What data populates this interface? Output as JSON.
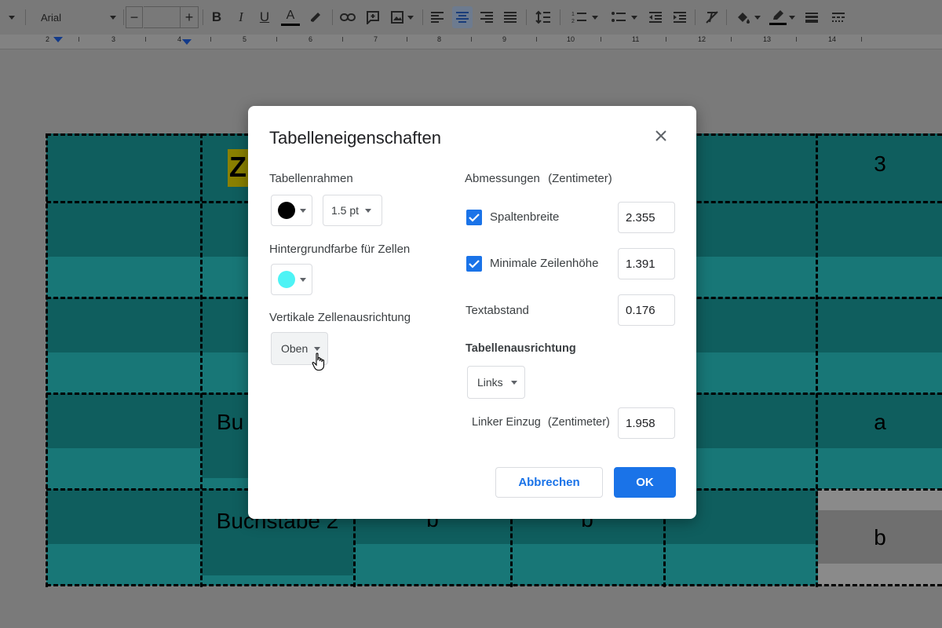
{
  "toolbar": {
    "font_name": "Arial",
    "font_size": "",
    "icons": [
      "menu-caret-icon",
      "font-caret-icon",
      "minus-icon",
      "plus-icon",
      "bold-icon",
      "italic-icon",
      "underline-icon",
      "text-color-icon",
      "highlight-icon",
      "link-icon",
      "comment-icon",
      "image-icon",
      "align-left-icon",
      "align-center-icon",
      "align-right-icon",
      "align-justify-icon",
      "line-spacing-icon",
      "numbered-list-icon",
      "bulleted-list-icon",
      "decrease-indent-icon",
      "increase-indent-icon",
      "clear-format-icon",
      "fill-color-icon",
      "border-color-icon",
      "border-width-icon",
      "border-dash-icon"
    ],
    "bold": "B",
    "italic": "I",
    "underline": "U",
    "text_color": "A",
    "minus": "−",
    "plus": "+"
  },
  "ruler": {
    "numbers": [
      "2",
      "3",
      "4",
      "5",
      "6",
      "7",
      "8",
      "9",
      "10",
      "11",
      "12",
      "13",
      "14"
    ]
  },
  "document_table": {
    "cells": {
      "r0c1": "Z",
      "r0c5": "3",
      "r3c1": "Bu",
      "r3c5": "a",
      "r4c1": "Buchstabe 2",
      "r4c2": "b",
      "r4c3": "b",
      "r4c5": "b"
    },
    "colors": {
      "dark": "#0f5e5e",
      "mid": "#136b6b",
      "light": "#187777",
      "highlight": "#8a8000",
      "gray": "#9a9a9a"
    }
  },
  "dialog": {
    "title": "Tabelleneigenschaften",
    "close_icon": "close-icon",
    "table_border": {
      "label": "Tabellenrahmen",
      "color": "#000000",
      "width": "1.5 pt"
    },
    "cell_background": {
      "label": "Hintergrundfarbe für Zellen",
      "color": "#4ef3f5"
    },
    "vertical_alignment": {
      "label": "Vertikale Zellenausrichtung",
      "value": "Oben"
    },
    "dimensions": {
      "label": "Abmessungen",
      "unit": "(Zentimeter)",
      "column_width": {
        "label": "Spaltenbreite",
        "checked": true,
        "value": "2.355"
      },
      "min_row_height": {
        "label": "Minimale Zeilenhöhe",
        "checked": true,
        "value": "1.391"
      },
      "cell_padding": {
        "label": "Textabstand",
        "value": "0.176"
      }
    },
    "table_alignment": {
      "label": "Tabellenausrichtung",
      "value": "Links"
    },
    "left_indent": {
      "label": "Linker Einzug",
      "unit": "(Zentimeter)",
      "value": "1.958"
    },
    "cancel_label": "Abbrechen",
    "ok_label": "OK",
    "accent": "#1a73e8"
  }
}
